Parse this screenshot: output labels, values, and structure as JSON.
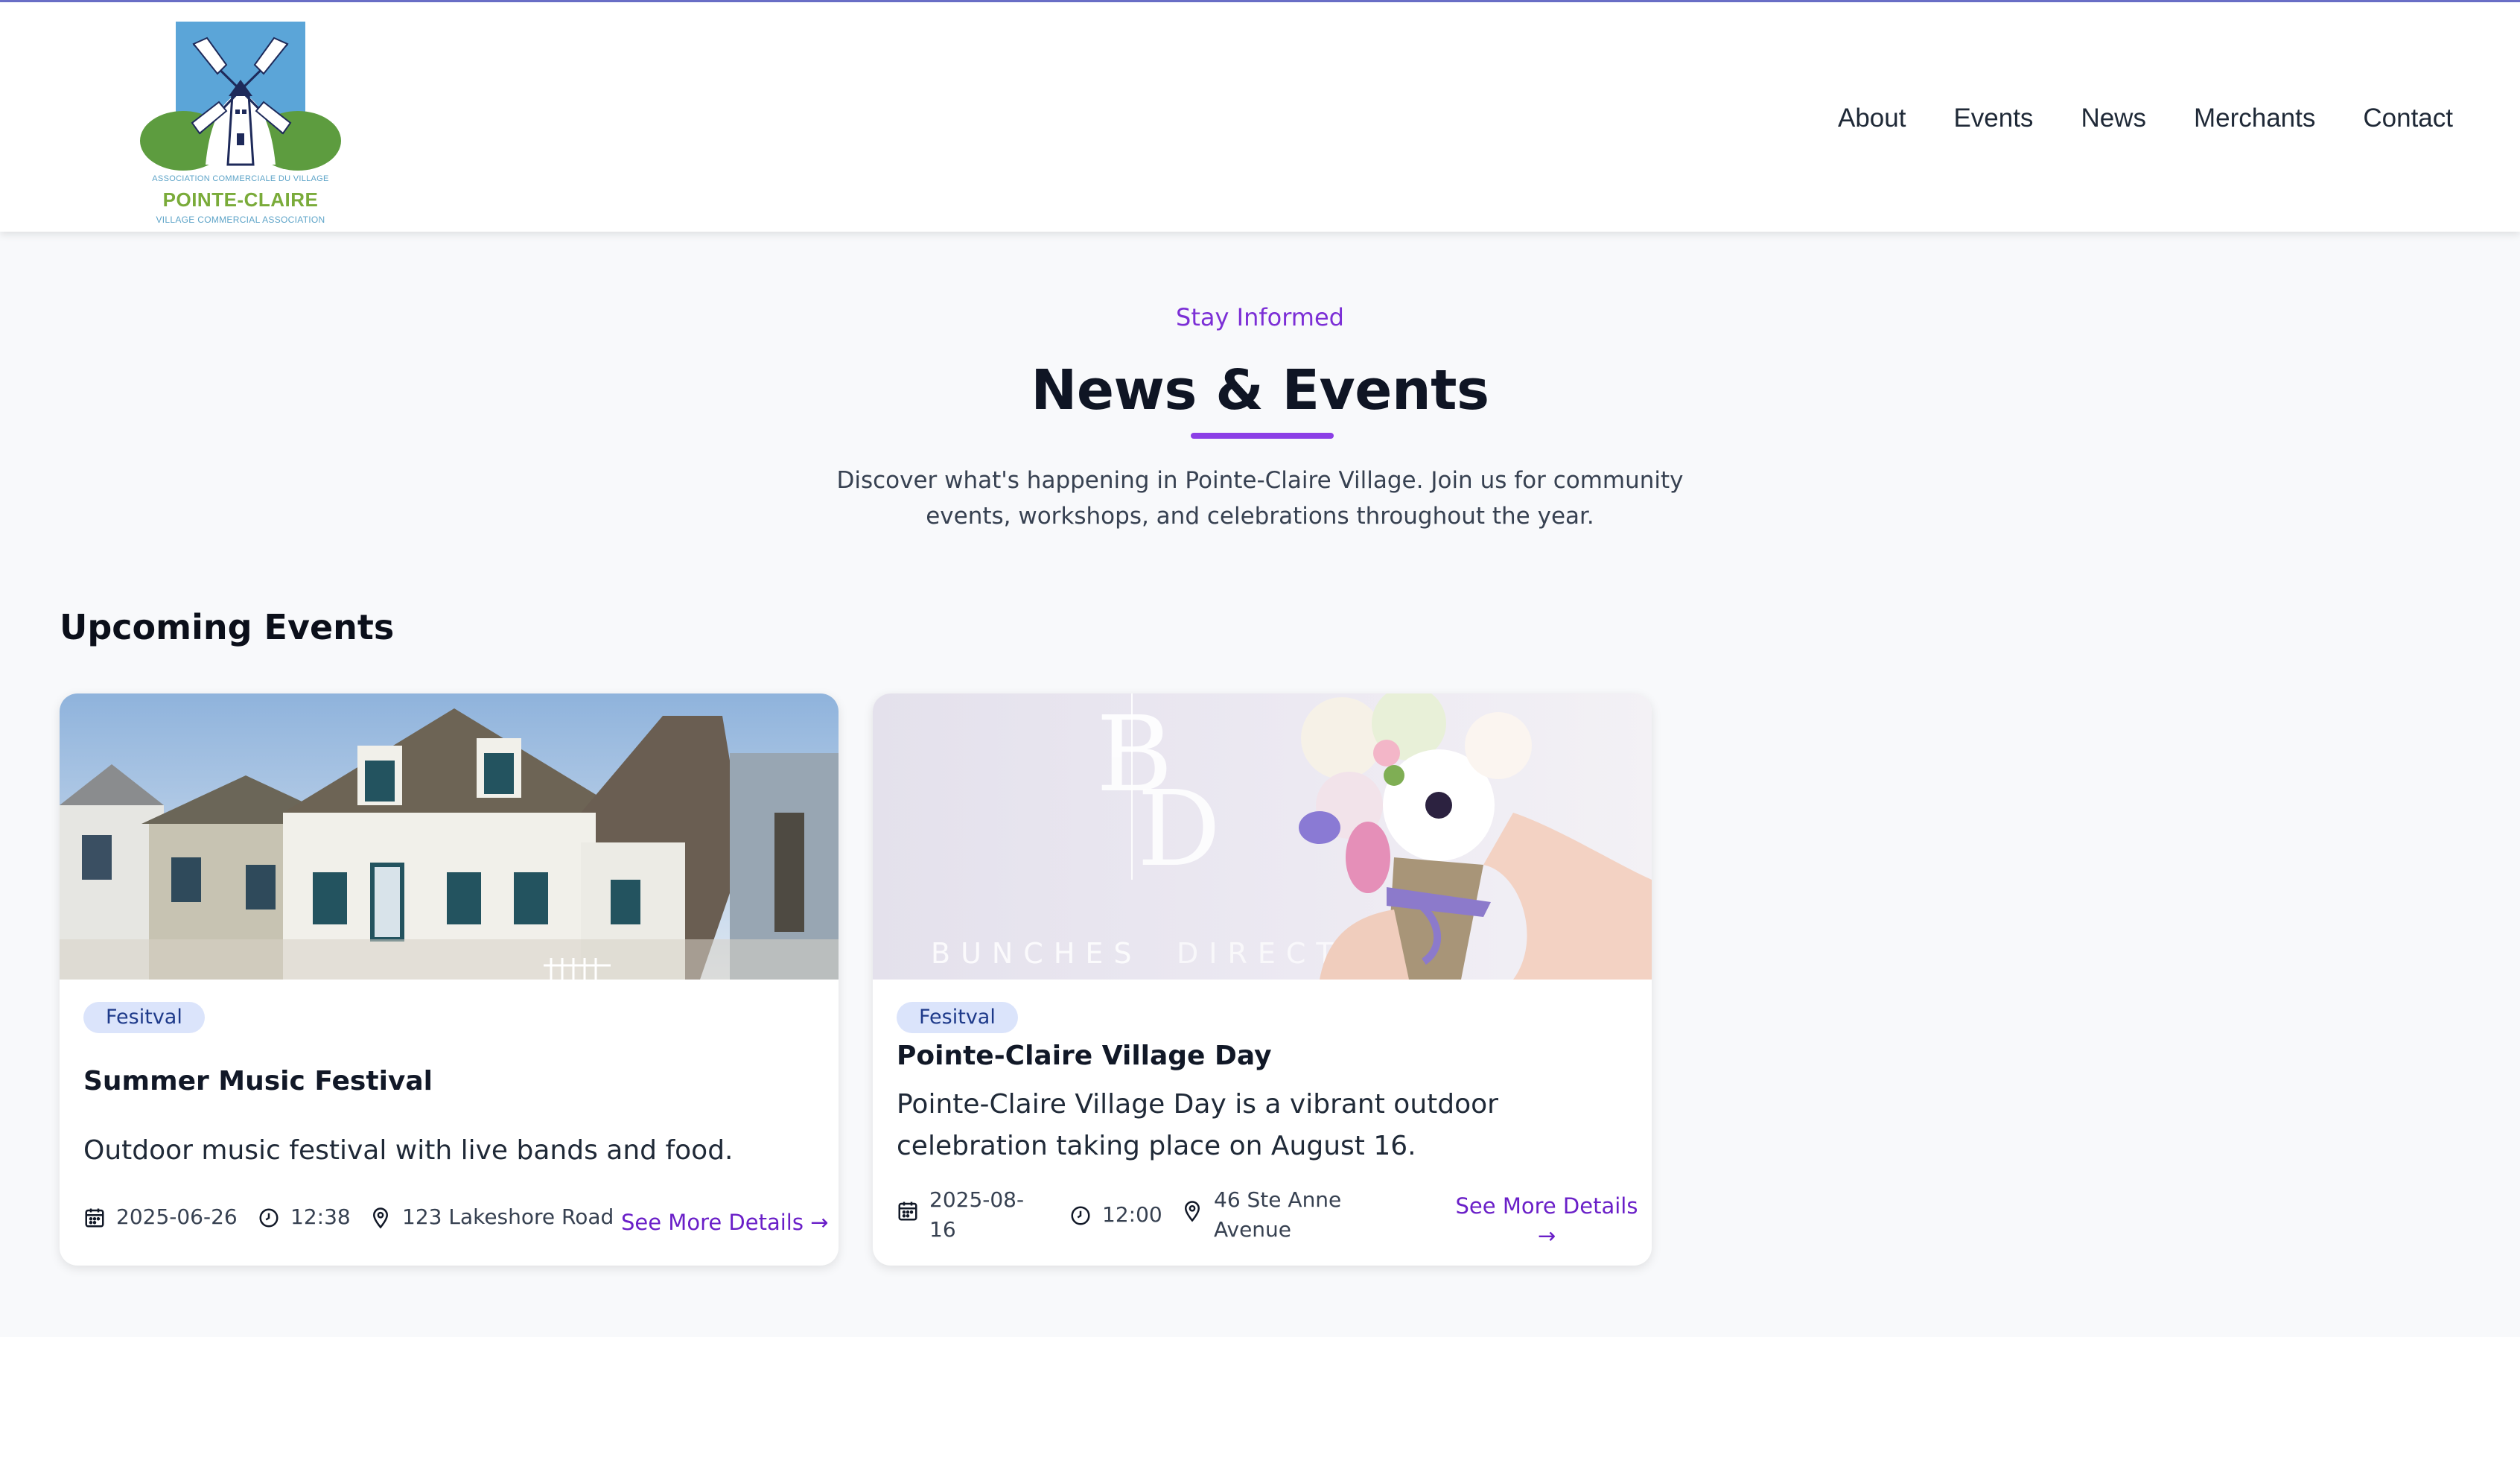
{
  "brand": {
    "line1": "ASSOCIATION COMMERCIALE DU VILLAGE",
    "line2": "POINTE-CLAIRE",
    "line3": "VILLAGE COMMERCIAL ASSOCIATION"
  },
  "nav": {
    "items": [
      {
        "label": "About"
      },
      {
        "label": "Events"
      },
      {
        "label": "News"
      },
      {
        "label": "Merchants"
      },
      {
        "label": "Contact"
      }
    ]
  },
  "hero": {
    "eyebrow": "Stay Informed",
    "title": "News & Events",
    "description": "Discover what's happening in Pointe-Claire Village. Join us for community events, workshops, and celebrations throughout the year."
  },
  "section": {
    "title": "Upcoming Events"
  },
  "events": [
    {
      "category": "Fesitval",
      "title": "Summer Music Festival",
      "description": "Outdoor music festival with live bands and food.",
      "date": "2025-06-26",
      "time": "12:38",
      "location": "123 Lakeshore Road",
      "link": "See More Details →"
    },
    {
      "category": "Fesitval",
      "title": "Pointe-Claire Village Day",
      "description": "Pointe-Claire Village Day is a vibrant outdoor celebration taking place on August 16.",
      "date_line1": "2025-08-",
      "date_line2": "16",
      "time": "12:00",
      "location_line1": "46 Ste Anne",
      "location_line2": "Avenue",
      "link_line1": "See More Details",
      "link_line2": "→",
      "image_text": {
        "monogram_top": "B",
        "monogram_bottom": "D",
        "brand_word1": "BUNCHES",
        "brand_word2": "DIRECT"
      }
    }
  ],
  "colors": {
    "accent": "#7c2fd6",
    "badge_bg": "#dbe4fb",
    "badge_text": "#1e3a8a",
    "page_bg": "#f8f9fb"
  },
  "icons": [
    "windmill-logo",
    "calendar-icon",
    "clock-icon",
    "map-pin-icon",
    "arrow-right-icon"
  ]
}
